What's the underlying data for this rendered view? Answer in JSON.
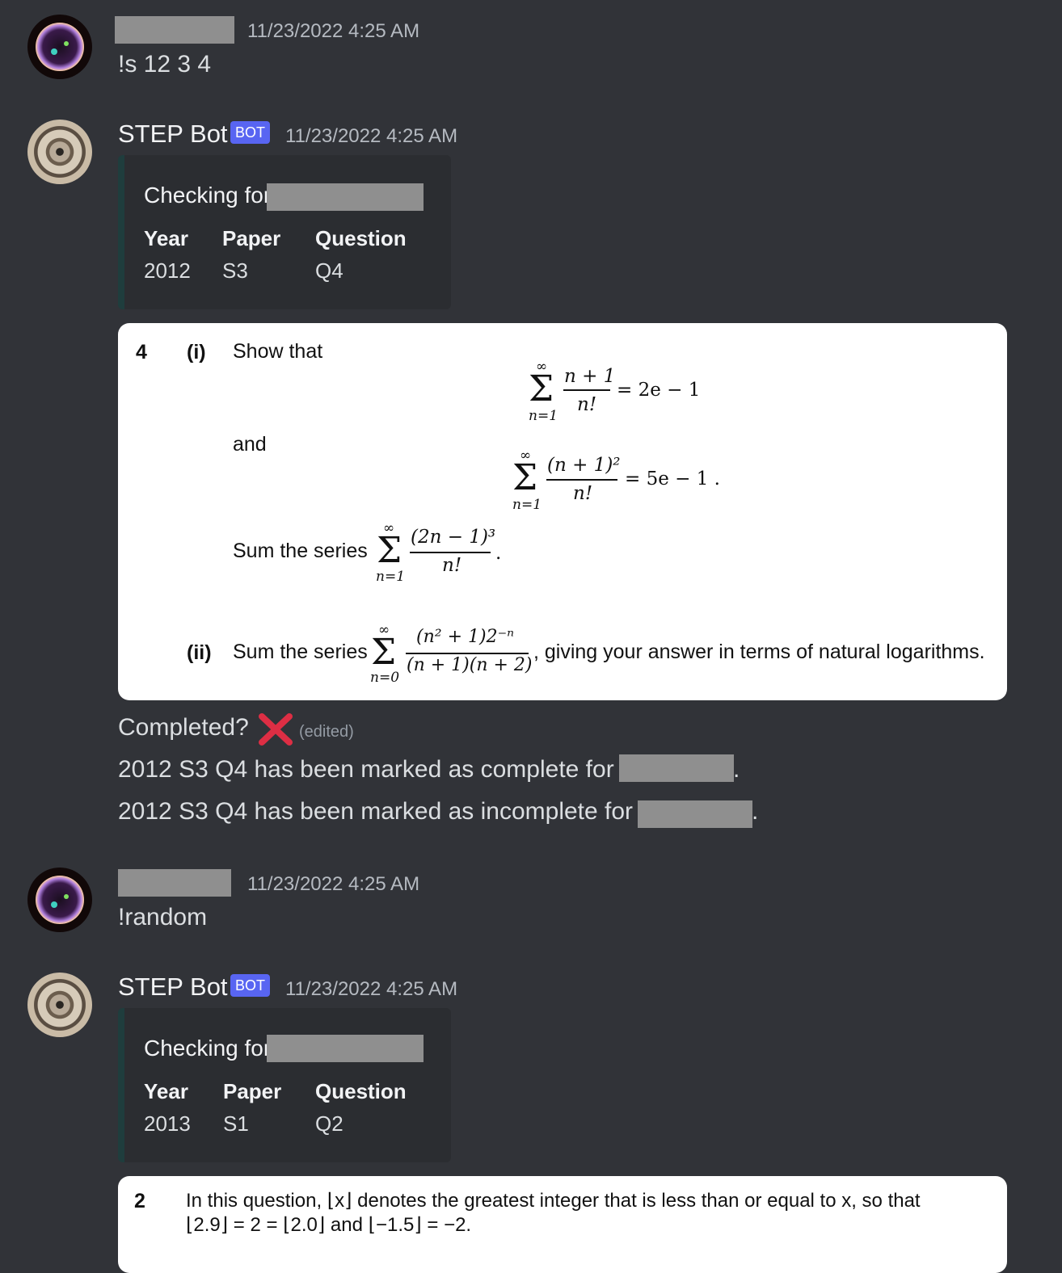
{
  "messages": [
    {
      "timestamp": "11/23/2022 4:25 AM",
      "text": "!s 12 3 4"
    },
    {
      "username": "STEP Bot",
      "bot_tag": "BOT",
      "timestamp": "11/23/2022 4:25 AM",
      "embed": {
        "title": "Checking for",
        "headers": [
          "Year",
          "Paper",
          "Question"
        ],
        "values": [
          "2012",
          "S3",
          "Q4"
        ]
      },
      "question": {
        "number": "4",
        "part1_label": "(i)",
        "show_that": "Show that",
        "and": "and",
        "sum_the_series": "Sum the series",
        "part2_label": "(ii)",
        "sum_the_series_2": "Sum the series",
        "giving": ", giving your answer in terms of natural logarithms.",
        "eq1_num": "n + 1",
        "eq1_den": "n!",
        "eq1_rhs": "= 2e − 1",
        "eq2_num": "(n + 1)²",
        "eq2_den": "n!",
        "eq2_rhs": "= 5e − 1 .",
        "eq3_num": "(2n − 1)³",
        "eq3_den": "n!",
        "eq4_num": "(n² + 1)2⁻ⁿ",
        "eq4_den": "(n + 1)(n + 2)",
        "sum_upper": "∞",
        "lower_n1": "n=1",
        "lower_n0": "n=0",
        "period": ".",
        "sigma": "Σ"
      },
      "completed_text": "Completed?",
      "edited": "(edited)",
      "complete_line": "2012 S3 Q4 has been marked as complete for",
      "incomplete_line": "2012 S3 Q4 has been marked as incomplete for",
      "period": "."
    },
    {
      "timestamp": "11/23/2022 4:25 AM",
      "text": "!random"
    },
    {
      "username": "STEP Bot",
      "bot_tag": "BOT",
      "timestamp": "11/23/2022 4:25 AM",
      "embed": {
        "title": "Checking for",
        "headers": [
          "Year",
          "Paper",
          "Question"
        ],
        "values": [
          "2013",
          "S1",
          "Q2"
        ]
      },
      "question": {
        "number": "2",
        "line1": "In this question, ⌊x⌋ denotes the greatest integer that is less than or equal to x, so that",
        "line2": "⌊2.9⌋ = 2 = ⌊2.0⌋ and ⌊−1.5⌋ = −2."
      }
    }
  ],
  "colors": {
    "background": "#313338",
    "embed_bg": "#2b2d31",
    "bot_tag": "#5865f2",
    "cross": "#dd2e44"
  }
}
